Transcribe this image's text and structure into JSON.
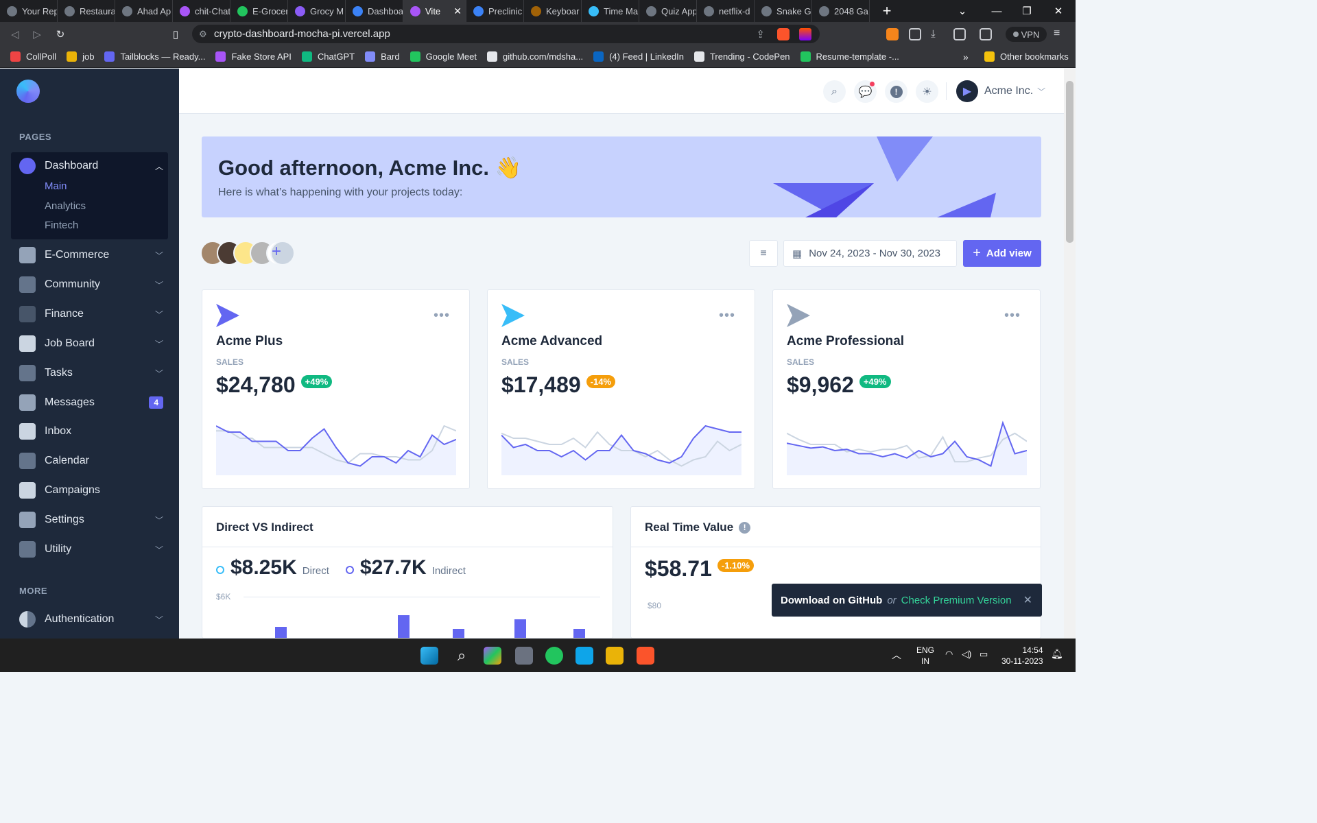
{
  "browser": {
    "tabs": [
      "Your Rep",
      "Restaura",
      "Ahad Ap",
      "chit-Chat",
      "E-Grocer",
      "Grocy M",
      "Dashboa",
      "Vite",
      "Preclinic",
      "Keyboar",
      "Time Ma",
      "Quiz App",
      "netflix-d",
      "Snake Ga",
      "2048 Ga"
    ],
    "active_tab": "Vite",
    "url": "crypto-dashboard-mocha-pi.vercel.app",
    "vpn_label": "VPN",
    "bookmarks": [
      "CollPoll",
      "job",
      "Tailblocks — Ready...",
      "Fake Store API",
      "ChatGPT",
      "Bard",
      "Google Meet",
      "github.com/mdsha...",
      "(4) Feed | LinkedIn",
      "Trending - CodePen",
      "Resume-template -..."
    ],
    "other_bookmarks": "Other bookmarks",
    "more_bookmarks": "»"
  },
  "sidebar": {
    "section_pages": "PAGES",
    "section_more": "MORE",
    "dashboard": "Dashboard",
    "dashboard_sub": [
      "Main",
      "Analytics",
      "Fintech"
    ],
    "items": [
      {
        "label": "E-Commerce",
        "chevron": true
      },
      {
        "label": "Community",
        "chevron": true
      },
      {
        "label": "Finance",
        "chevron": true
      },
      {
        "label": "Job Board",
        "chevron": true
      },
      {
        "label": "Tasks",
        "chevron": true
      },
      {
        "label": "Messages",
        "badge": "4"
      },
      {
        "label": "Inbox"
      },
      {
        "label": "Calendar"
      },
      {
        "label": "Campaigns"
      },
      {
        "label": "Settings",
        "chevron": true
      },
      {
        "label": "Utility",
        "chevron": true
      }
    ],
    "authentication": "Authentication"
  },
  "header": {
    "account": "Acme Inc."
  },
  "banner": {
    "title": "Good afternoon, Acme Inc. 👋",
    "subtitle": "Here is what’s happening with your projects today:"
  },
  "toolbar": {
    "date_range": "Nov 24, 2023 - Nov 30, 2023",
    "add_view": "Add view"
  },
  "cards": [
    {
      "title": "Acme Plus",
      "label": "SALES",
      "value": "$24,780",
      "change": "+49%",
      "change_color": "#10b981",
      "icon_color": "#6366f1",
      "series_a": [
        80,
        70,
        70,
        55,
        55,
        55,
        40,
        40,
        60,
        75,
        45,
        20,
        15,
        30,
        30,
        20,
        40,
        30,
        65,
        50,
        58
      ],
      "series_b": [
        72,
        72,
        60,
        60,
        45,
        45,
        45,
        45,
        45,
        35,
        25,
        20,
        35,
        35,
        30,
        30,
        25,
        25,
        40,
        80,
        72
      ]
    },
    {
      "title": "Acme Advanced",
      "label": "SALES",
      "value": "$17,489",
      "change": "-14%",
      "change_color": "#f59e0b",
      "icon_color": "#38bdf8",
      "series_a": [
        65,
        45,
        50,
        40,
        40,
        30,
        40,
        25,
        40,
        40,
        65,
        40,
        35,
        25,
        20,
        30,
        60,
        80,
        75,
        70,
        70
      ],
      "series_b": [
        68,
        60,
        60,
        55,
        50,
        50,
        60,
        45,
        70,
        50,
        40,
        40,
        30,
        40,
        25,
        15,
        25,
        30,
        55,
        40,
        50
      ]
    },
    {
      "title": "Acme Professional",
      "label": "SALES",
      "value": "$9,962",
      "change": "+49%",
      "change_color": "#10b981",
      "icon_color": "#94a3b8",
      "series_a": [
        52,
        48,
        44,
        46,
        40,
        42,
        35,
        35,
        30,
        35,
        28,
        40,
        30,
        35,
        55,
        30,
        25,
        15,
        85,
        35,
        40
      ],
      "series_b": [
        68,
        58,
        50,
        50,
        50,
        38,
        42,
        38,
        42,
        42,
        48,
        28,
        32,
        62,
        22,
        22,
        28,
        32,
        58,
        68,
        55
      ]
    }
  ],
  "direct_vs_indirect": {
    "title": "Direct VS Indirect",
    "direct_value": "$8.25K",
    "direct_label": "Direct",
    "indirect_value": "$27.7K",
    "indirect_label": "Indirect",
    "y_tick": "$6K"
  },
  "real_time": {
    "title": "Real Time Value",
    "value": "$58.71",
    "change": "-1.10%",
    "y_tick": "$80"
  },
  "toast": {
    "primary": "Download on GitHub",
    "or": "or",
    "secondary": "Check Premium Version"
  },
  "taskbar": {
    "lang_1": "ENG",
    "lang_2": "IN",
    "time": "14:54",
    "date": "30-11-2023"
  }
}
